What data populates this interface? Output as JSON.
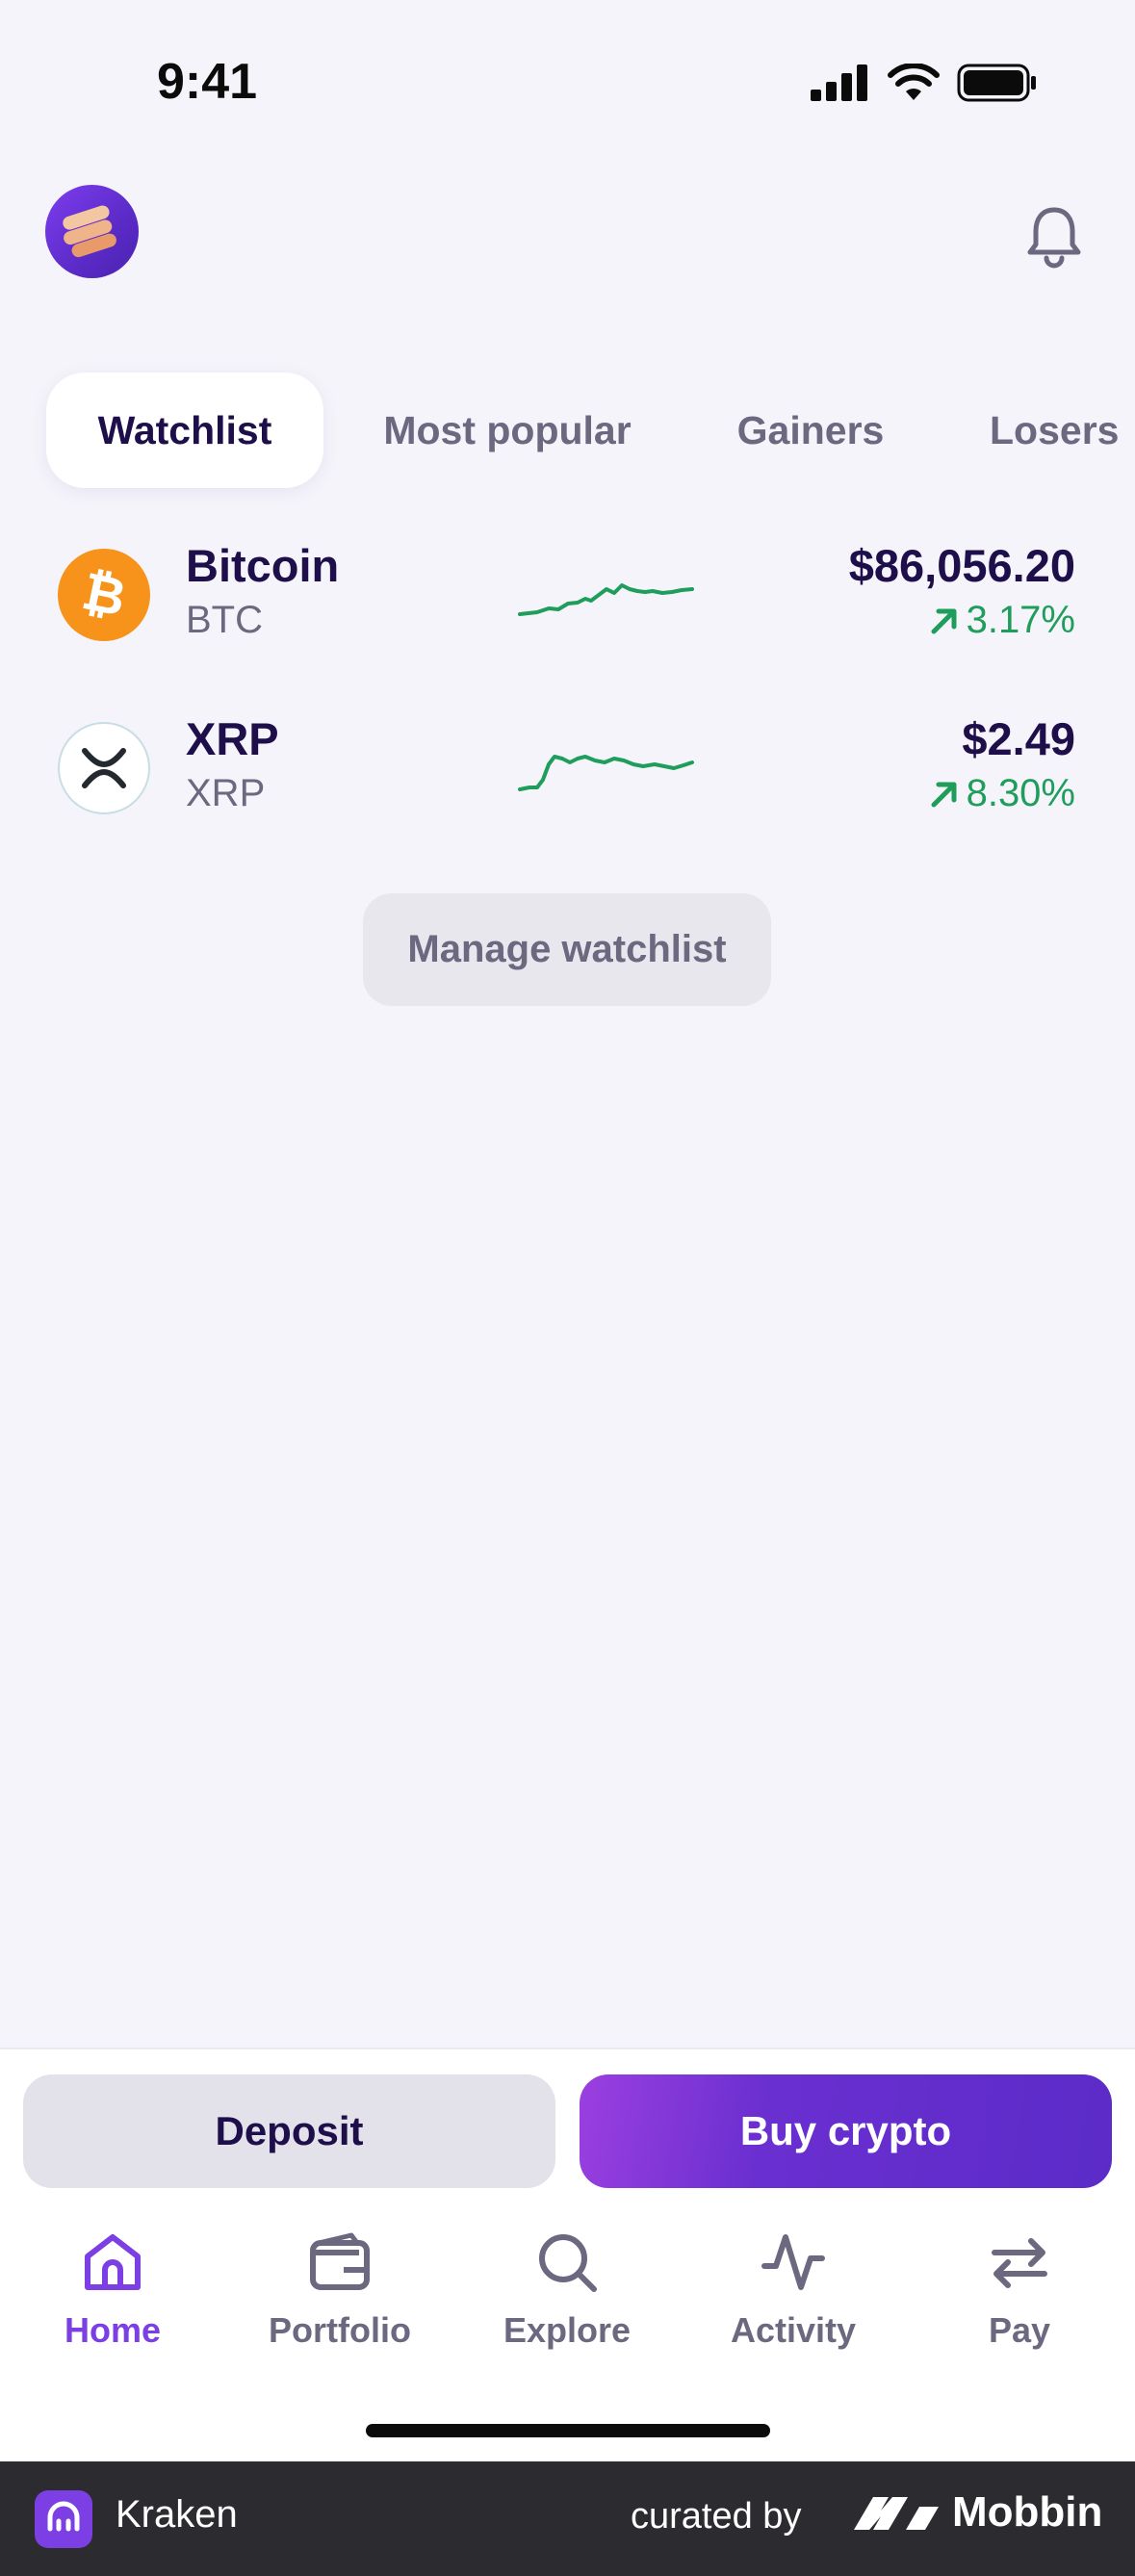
{
  "status_bar": {
    "time": "9:41"
  },
  "tabs": [
    {
      "label": "Watchlist",
      "active": true
    },
    {
      "label": "Most popular",
      "active": false
    },
    {
      "label": "Gainers",
      "active": false
    },
    {
      "label": "Losers",
      "active": false
    }
  ],
  "watchlist": [
    {
      "name": "Bitcoin",
      "symbol": "BTC",
      "price": "$86,056.20",
      "change": "3.17%",
      "logo": "bitcoin-logo",
      "color": "#f7931a"
    },
    {
      "name": "XRP",
      "symbol": "XRP",
      "price": "$2.49",
      "change": "8.30%",
      "logo": "xrp-logo",
      "color": "#ffffff"
    }
  ],
  "manage_watchlist_label": "Manage watchlist",
  "actions": {
    "deposit_label": "Deposit",
    "buy_label": "Buy crypto"
  },
  "nav": [
    {
      "label": "Home",
      "icon": "home-icon",
      "active": true
    },
    {
      "label": "Portfolio",
      "icon": "wallet-icon",
      "active": false
    },
    {
      "label": "Explore",
      "icon": "search-icon",
      "active": false
    },
    {
      "label": "Activity",
      "icon": "activity-icon",
      "active": false
    },
    {
      "label": "Pay",
      "icon": "transfer-icon",
      "active": false
    }
  ],
  "footer": {
    "app_name": "Kraken",
    "curated_by": "curated by",
    "brand": "Mobbin"
  },
  "colors": {
    "accent": "#7b3fe4",
    "positive": "#1f9d5b",
    "text_primary": "#1e0f4a",
    "text_secondary": "#6b6880"
  }
}
